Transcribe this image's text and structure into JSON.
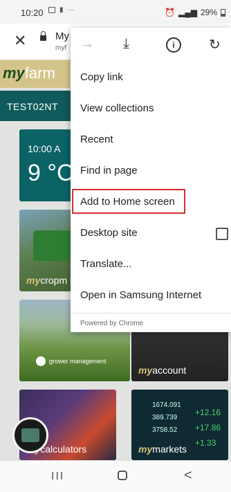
{
  "status_bar": {
    "time": "10:20",
    "ellipsis": "···",
    "battery_text": "29%"
  },
  "address_bar": {
    "title": "My",
    "subtitle": "myf"
  },
  "page": {
    "brand_my": "my",
    "brand_farm": "farm",
    "account_code": "TEST02NT",
    "weather_time": "10:00 A",
    "weather_temp": "9 °C",
    "tiles": {
      "crop_my": "my",
      "crop_rest": "cropm",
      "grower": "grower management",
      "account_my": "my",
      "account_rest": "account",
      "calc_my": "my",
      "calc_rest": "calculators",
      "markets_my": "my",
      "markets_rest": "markets"
    },
    "market_numbers": [
      "1674.091",
      "389.739",
      "3758.52",
      "+12.16",
      "+17.86",
      "+1.33"
    ]
  },
  "menu": {
    "items": [
      "Copy link",
      "View collections",
      "Recent",
      "Find in page",
      "Add to Home screen",
      "Desktop site",
      "Translate...",
      "Open in Samsung Internet"
    ],
    "powered_by": "Powered by Chrome",
    "highlighted_item": "Add to Home screen",
    "desktop_site_checked": false
  },
  "nav_bar": {
    "recent_glyph": "III",
    "back_glyph": "<"
  },
  "colors": {
    "highlight_border": "#d32f2f",
    "teal": "#0f5a5b",
    "brand_bar": "#d5c48a"
  },
  "icons": [
    "forward-arrow-icon",
    "download-icon",
    "info-icon",
    "refresh-icon",
    "close-icon",
    "lock-icon",
    "checkbox-icon"
  ]
}
